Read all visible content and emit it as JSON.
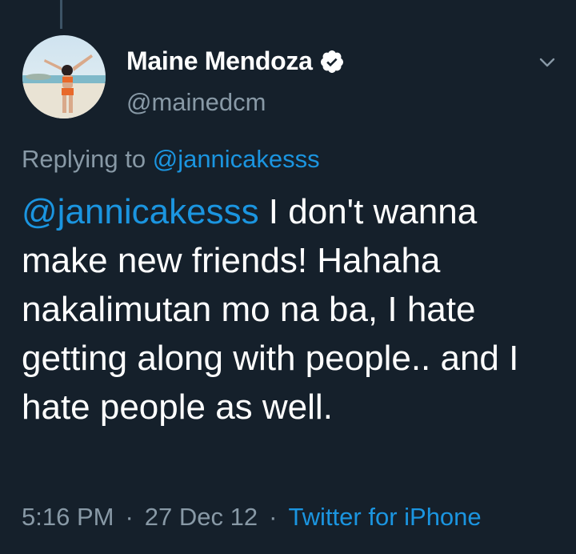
{
  "tweet": {
    "author": {
      "display_name": "Maine Mendoza",
      "handle": "@mainedcm",
      "verified": true
    },
    "reply_prefix": "Replying to",
    "reply_to": "@jannicakesss",
    "mention": "@jannicakesss",
    "text_line1": " I don't",
    "text_rest": "wanna make new friends! Hahaha nakalimutan mo na ba, I hate getting along with people.. and I hate people as well.",
    "time": "5:16 PM",
    "separator": "·",
    "date": "27 Dec 12",
    "source": "Twitter for iPhone"
  },
  "icons": {
    "verified": "verified-badge-icon",
    "caret": "chevron-down-icon"
  },
  "colors": {
    "background": "#15202b",
    "link": "#1b95e0",
    "secondary_text": "#8899a6",
    "primary_text": "#ffffff"
  }
}
